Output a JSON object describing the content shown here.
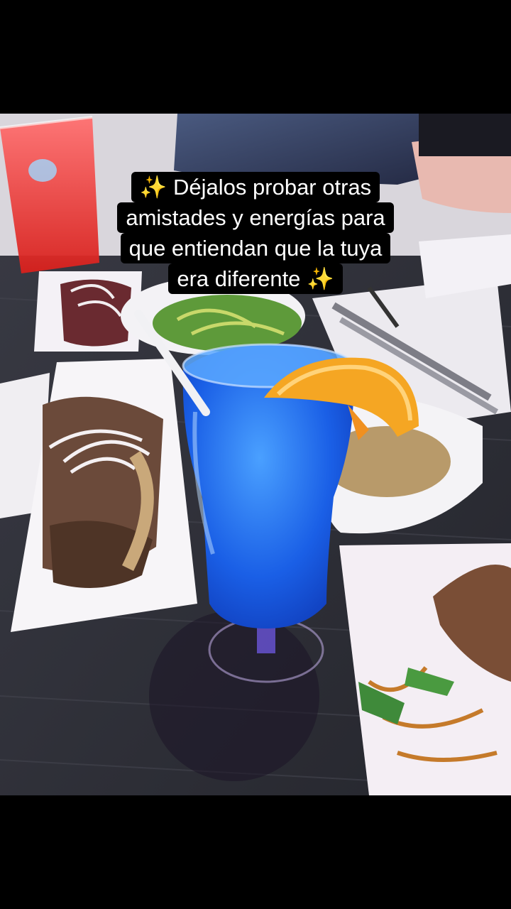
{
  "caption": {
    "line1": "✨ Déjalos probar otras",
    "line2": "amistades y energías para",
    "line3": "que entiendan que la tuya",
    "line4": "era diferente ✨"
  },
  "colors": {
    "letterbox": "#000000",
    "drink_blue": "#1f6bff",
    "orange_slice": "#f5a623",
    "table": "#2c2d33"
  }
}
